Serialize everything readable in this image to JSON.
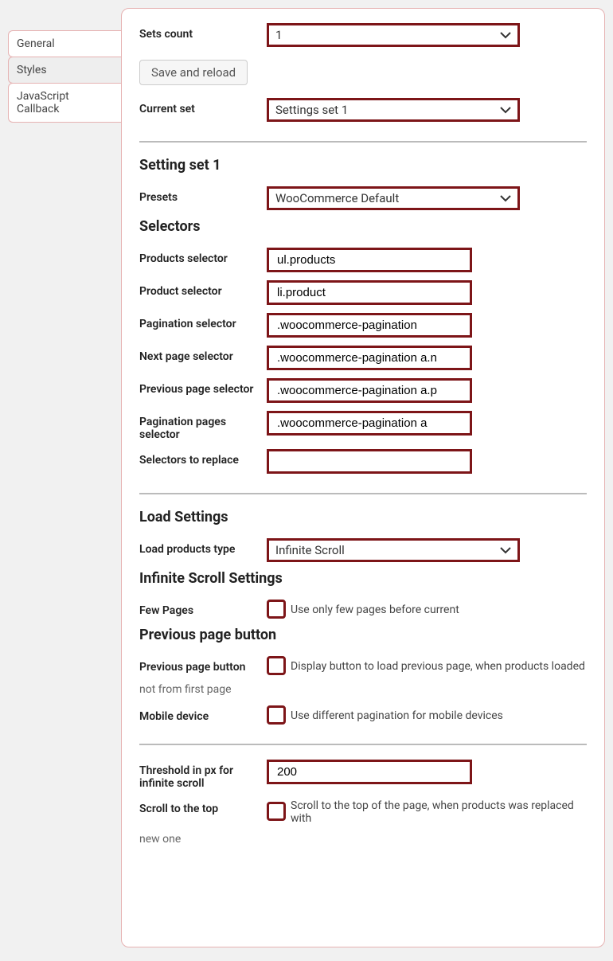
{
  "tabs": {
    "general": "General",
    "styles": "Styles",
    "js_callback": "JavaScript Callback"
  },
  "top": {
    "sets_count_label": "Sets count",
    "sets_count_value": "1",
    "save_reload_label": "Save and reload",
    "current_set_label": "Current set",
    "current_set_value": "Settings set 1"
  },
  "set_heading": "Setting set 1",
  "presets": {
    "label": "Presets",
    "value": "WooCommerce Default"
  },
  "selectors": {
    "heading": "Selectors",
    "products_label": "Products selector",
    "products_value": "ul.products",
    "product_label": "Product selector",
    "product_value": "li.product",
    "pagination_label": "Pagination selector",
    "pagination_value": ".woocommerce-pagination",
    "next_label": "Next page selector",
    "next_value": ".woocommerce-pagination a.n",
    "prev_label": "Previous page selector",
    "prev_value": ".woocommerce-pagination a.p",
    "pages_label": "Pagination pages selector",
    "pages_value": ".woocommerce-pagination a",
    "replace_label": "Selectors to replace",
    "replace_value": ""
  },
  "load": {
    "heading": "Load Settings",
    "type_label": "Load products type",
    "type_value": "Infinite Scroll"
  },
  "infinite": {
    "heading": "Infinite Scroll Settings",
    "few_pages_label": "Few Pages",
    "few_pages_cb": "Use only few pages before current"
  },
  "prev_btn": {
    "heading": "Previous page button",
    "label": "Previous page button",
    "cb": "Display button to load previous page, when products loaded",
    "trailing": "not from first page",
    "mobile_label": "Mobile device",
    "mobile_cb": "Use different pagination for mobile devices"
  },
  "threshold": {
    "label": "Threshold in px for infinite scroll",
    "value": "200",
    "scroll_top_label": "Scroll to the top",
    "scroll_top_cb": "Scroll to the top of the page, when products was replaced with",
    "scroll_top_trailing": "new one"
  }
}
